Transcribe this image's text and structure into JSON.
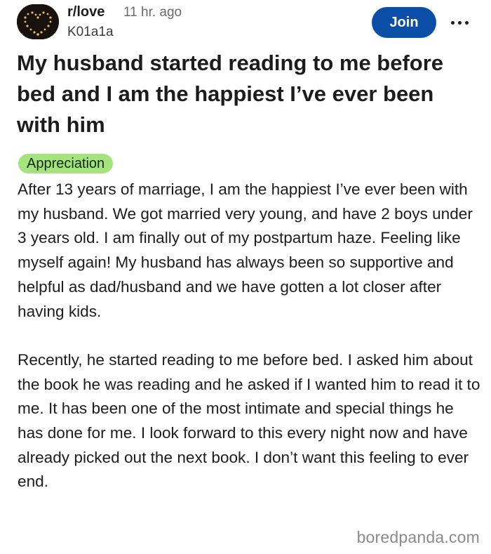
{
  "post": {
    "subreddit": "r/love",
    "time_ago": "11 hr. ago",
    "author": "K01a1a",
    "join_label": "Join",
    "more_icon": "more-horizontal-icon",
    "title": "My husband started reading to me before bed and I am the happiest I’ve ever been with him",
    "flair": "Appreciation",
    "body": [
      "After 13 years of marriage, I am the happiest I’ve ever been with my husband. We got married very young, and have 2 boys under 3 years old. I am finally out of my postpartum haze. Feeling like myself again! My husband has always been so supportive and helpful as dad/husband and we have gotten a lot closer after having kids.",
      "Recently, he started reading to me before bed. I asked him about the book he was reading and he asked if I wanted him to read it to me. It has been one of the most intimate and special things he has done for me. I look forward to this every night now and have already picked out the next book. I don’t want this feeling to ever end."
    ]
  },
  "watermark": "boredpanda.com",
  "colors": {
    "join_button": "#0a4ea8",
    "flair_background": "#a4e37d",
    "text": "#1c1c1c"
  }
}
